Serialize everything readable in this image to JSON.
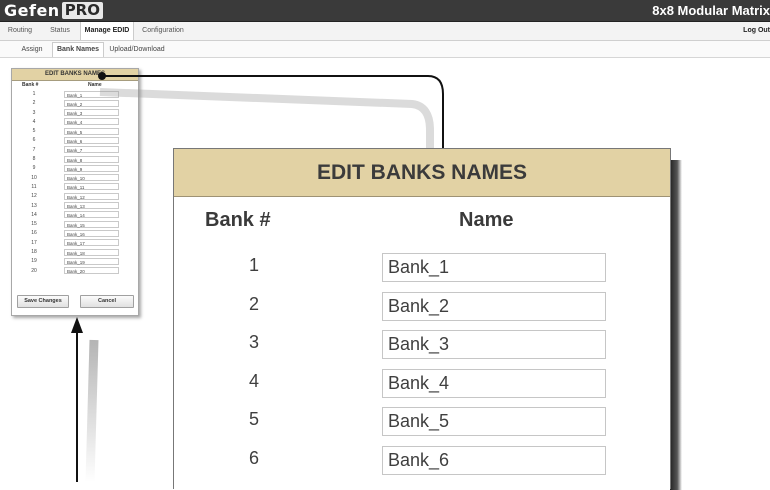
{
  "header": {
    "logo_word": "Gefen",
    "logo_badge": "PRO",
    "product_title": "8x8 Modular Matrix"
  },
  "main_tabs": [
    "Routing",
    "Status",
    "Manage EDID",
    "Configuration"
  ],
  "active_main_tab": "Manage EDID",
  "logout_label": "Log Out",
  "sub_tabs": [
    "Assign",
    "Bank Names",
    "Upload/Download"
  ],
  "active_sub_tab": "Bank Names",
  "panel": {
    "title": "EDIT BANKS NAMES",
    "col_bank": "Bank #",
    "col_name": "Name",
    "rows": [
      {
        "num": "1",
        "name": "Bank_1"
      },
      {
        "num": "2",
        "name": "Bank_2"
      },
      {
        "num": "3",
        "name": "Bank_3"
      },
      {
        "num": "4",
        "name": "Bank_4"
      },
      {
        "num": "5",
        "name": "Bank_5"
      },
      {
        "num": "6",
        "name": "Bank_6"
      },
      {
        "num": "7",
        "name": "Bank_7"
      },
      {
        "num": "8",
        "name": "Bank_8"
      },
      {
        "num": "9",
        "name": "Bank_9"
      },
      {
        "num": "10",
        "name": "Bank_10"
      },
      {
        "num": "11",
        "name": "Bank_11"
      },
      {
        "num": "12",
        "name": "Bank_12"
      },
      {
        "num": "13",
        "name": "Bank_13"
      },
      {
        "num": "14",
        "name": "Bank_14"
      },
      {
        "num": "15",
        "name": "Bank_15"
      },
      {
        "num": "16",
        "name": "Bank_16"
      },
      {
        "num": "17",
        "name": "Bank_17"
      },
      {
        "num": "18",
        "name": "Bank_18"
      },
      {
        "num": "19",
        "name": "Bank_19"
      },
      {
        "num": "20",
        "name": "Bank_20"
      }
    ],
    "save_label": "Save Changes",
    "cancel_label": "Cancel"
  },
  "zoom": {
    "title": "EDIT BANKS NAMES",
    "col_bank": "Bank #",
    "col_name": "Name",
    "rows": [
      {
        "num": "1",
        "name": "Bank_1"
      },
      {
        "num": "2",
        "name": "Bank_2"
      },
      {
        "num": "3",
        "name": "Bank_3"
      },
      {
        "num": "4",
        "name": "Bank_4"
      },
      {
        "num": "5",
        "name": "Bank_5"
      },
      {
        "num": "6",
        "name": "Bank_6"
      }
    ]
  },
  "colors": {
    "header_bar": "#3a3a3a",
    "panel_header": "#e2d2a4"
  }
}
